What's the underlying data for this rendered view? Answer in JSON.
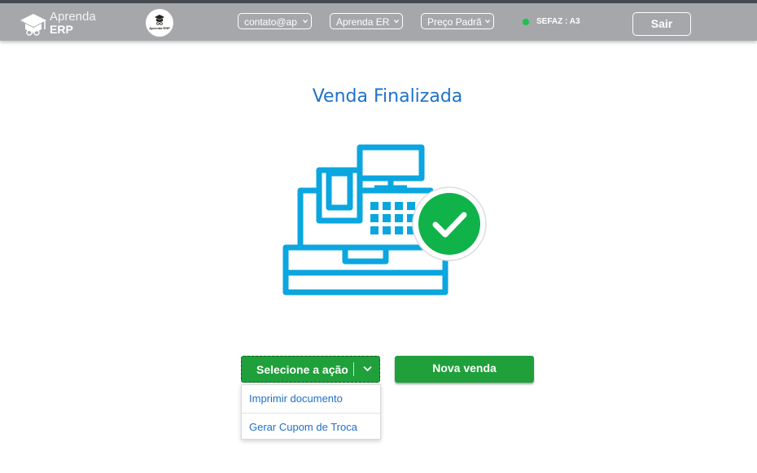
{
  "header": {
    "brand_line1": "Aprenda",
    "brand_line2": "ERP",
    "avatar_label": "Aprenda ERP",
    "account_select": "contato@ap",
    "company_select": "Aprenda ER",
    "price_select": "Preço Padrã",
    "sefaz_status": "SEFAZ : A3",
    "logout_label": "Sair"
  },
  "main": {
    "title": "Venda Finalizada",
    "action_button": "Selecione a ação",
    "new_sale_button": "Nova venda",
    "action_menu": [
      "Imprimir documento",
      "Gerar Cupom de Troca"
    ]
  },
  "colors": {
    "header_bg": "#a5a7ab",
    "accent_blue": "#1f72c8",
    "register_blue": "#0aa6e0",
    "success_green": "#1fa03b",
    "status_green": "#1fc24a"
  },
  "icons": [
    "graduation-cap-icon",
    "chevron-down-icon",
    "cash-register-icon",
    "check-circle-icon"
  ]
}
